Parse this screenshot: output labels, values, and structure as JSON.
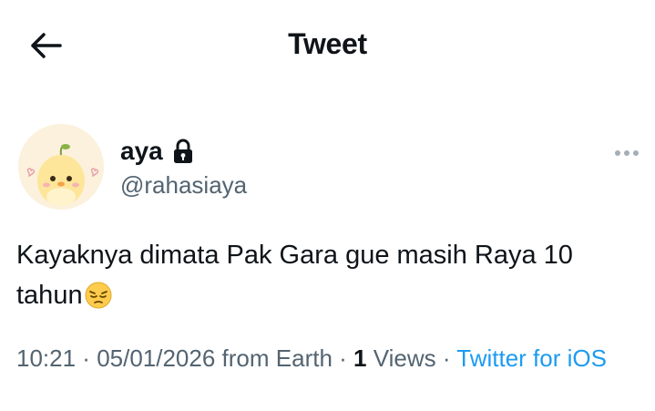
{
  "header": {
    "title": "Tweet"
  },
  "author": {
    "display_name": "aya",
    "handle": "@rahasiaya",
    "protected_icon": "lock-icon"
  },
  "tweet": {
    "text": "Kayaknya dimata Pak Gara gue masih Raya 10 tahun",
    "emoji": "😔"
  },
  "meta": {
    "time": "10:21",
    "sep1": " · ",
    "date": "05/01/2026",
    "location": " from Earth",
    "sep2": " · ",
    "views_count": "1",
    "views_label": " Views",
    "sep3": " · ",
    "source": "Twitter for iOS"
  },
  "icons": {
    "back": "arrow-left-icon",
    "more": "more-horizontal-icon"
  },
  "colors": {
    "text_primary": "#0f1419",
    "text_secondary": "#536471",
    "link": "#1d9bf0"
  }
}
